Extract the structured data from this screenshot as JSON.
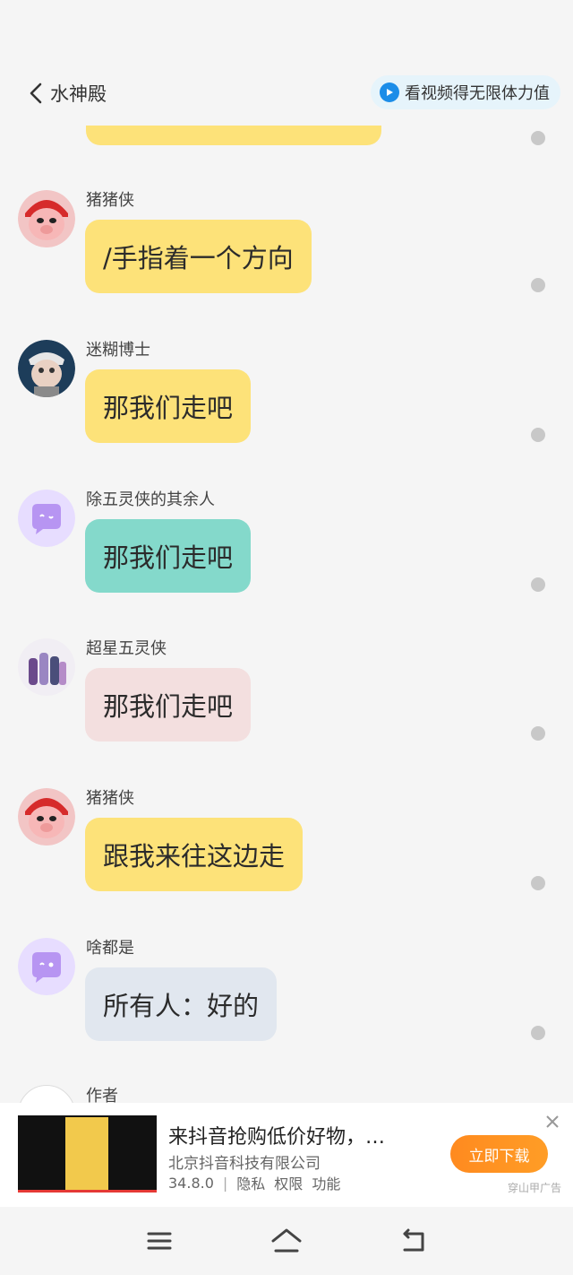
{
  "header": {
    "title": "水神殿",
    "reward_label": "看视频得无限体力值"
  },
  "messages": [
    {
      "sender": "猪猪侠",
      "text": "/手指着一个方向",
      "bubble_color": "#fde279",
      "avatar": "pig-hero-avatar"
    },
    {
      "sender": "迷糊博士",
      "text": "那我们走吧",
      "bubble_color": "#fde279",
      "avatar": "doctor-avatar"
    },
    {
      "sender": "除五灵侠的其余人",
      "text": "那我们走吧",
      "bubble_color": "#84d9cb",
      "avatar": "chat-bubble-avatar"
    },
    {
      "sender": "超星五灵侠",
      "text": "那我们走吧",
      "bubble_color": "#f3dfdf",
      "avatar": "group-avatar"
    },
    {
      "sender": "猪猪侠",
      "text": "跟我来往这边走",
      "bubble_color": "#fde279",
      "avatar": "pig-hero-avatar"
    },
    {
      "sender": "啥都是",
      "text": "所有人：好的",
      "bubble_color": "#e1e7ef",
      "avatar": "chat-bubble-avatar"
    }
  ],
  "next_sender": "作者",
  "ad": {
    "title": "来抖音抢购低价好物，…",
    "company": "北京抖音科技有限公司",
    "version": "34.8.0",
    "privacy": "隐私",
    "permissions": "权限",
    "features": "功能",
    "download_label": "立即下载",
    "source": "穿山甲广告"
  },
  "colors": {
    "accent": "#1c8de8",
    "yellow_bubble": "#fde279",
    "teal_bubble": "#84d9cb",
    "pink_bubble": "#f3dfdf",
    "gray_bubble": "#e1e7ef",
    "download_button": "#ff8a1f"
  }
}
